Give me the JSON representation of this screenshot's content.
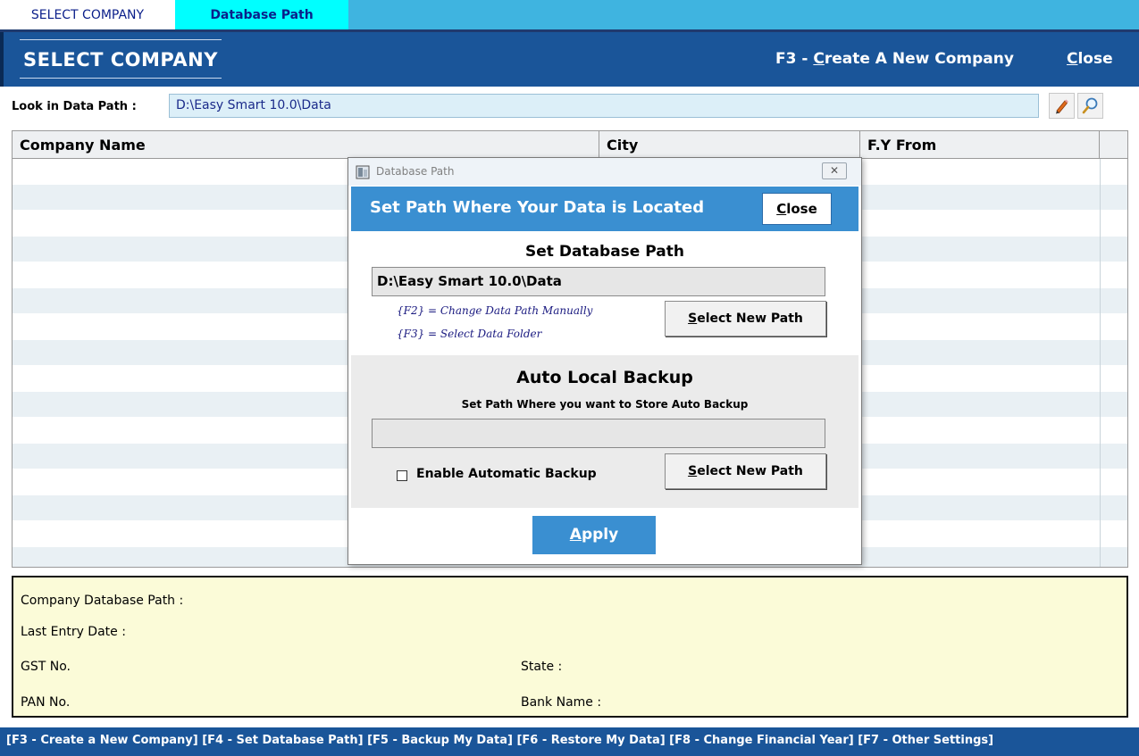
{
  "tabs": [
    {
      "label": "SELECT COMPANY"
    },
    {
      "label": "Database Path"
    }
  ],
  "header": {
    "title": "SELECT COMPANY",
    "new_company_key": "F3 - ",
    "new_company_underlined": "C",
    "new_company_rest": "reate A New Company",
    "close_underlined": "C",
    "close_rest": "lose"
  },
  "look_in": {
    "label": "Look in Data Path :",
    "value": "D:\\Easy Smart 10.0\\Data",
    "edit_icon": "pencil-icon",
    "find_icon": "magnifier-icon"
  },
  "grid": {
    "columns": [
      "Company Name",
      "City",
      "F.Y From"
    ],
    "rows": []
  },
  "info_panel": {
    "database_path_label": "Company Database Path :",
    "last_entry_label": "Last Entry Date :",
    "gst_label": "GST No.",
    "state_label": "State :",
    "pan_label": "PAN No.",
    "bank_label": "Bank Name :"
  },
  "bottom_bar": "[F3 - Create a New Company] [F4 - Set Database Path] [F5 - Backup My Data] [F6 - Restore My Data] [F8 - Change Financial Year] [F7 - Other Settings]",
  "dialog": {
    "window_title": "Database Path",
    "close_x": "✕",
    "banner_title": "Set Path Where Your Data is Located",
    "close_btn_underlined": "C",
    "close_btn_rest": "lose",
    "db_heading": "Set Database Path",
    "db_path": "D:\\Easy Smart 10.0\\Data",
    "hint_f2": "{F2} = Change Data Path Manually",
    "hint_f3": "{F3} = Select Data Folder",
    "select_btn_underlined": "S",
    "select_btn_rest": "elect New Path",
    "backup_heading": "Auto Local Backup",
    "backup_sub": "Set Path Where you want to Store Auto Backup",
    "backup_path": "",
    "enable_backup_label": "Enable Automatic Backup",
    "enable_backup_checked": false,
    "apply_underlined": "A",
    "apply_rest": "pply"
  },
  "colors": {
    "header_blue": "#1a5599",
    "tab_strip": "#3fb4e0",
    "active_tab": "#00ffff",
    "dialog_banner": "#3a8fd1",
    "info_panel_bg": "#fbfbd8"
  }
}
